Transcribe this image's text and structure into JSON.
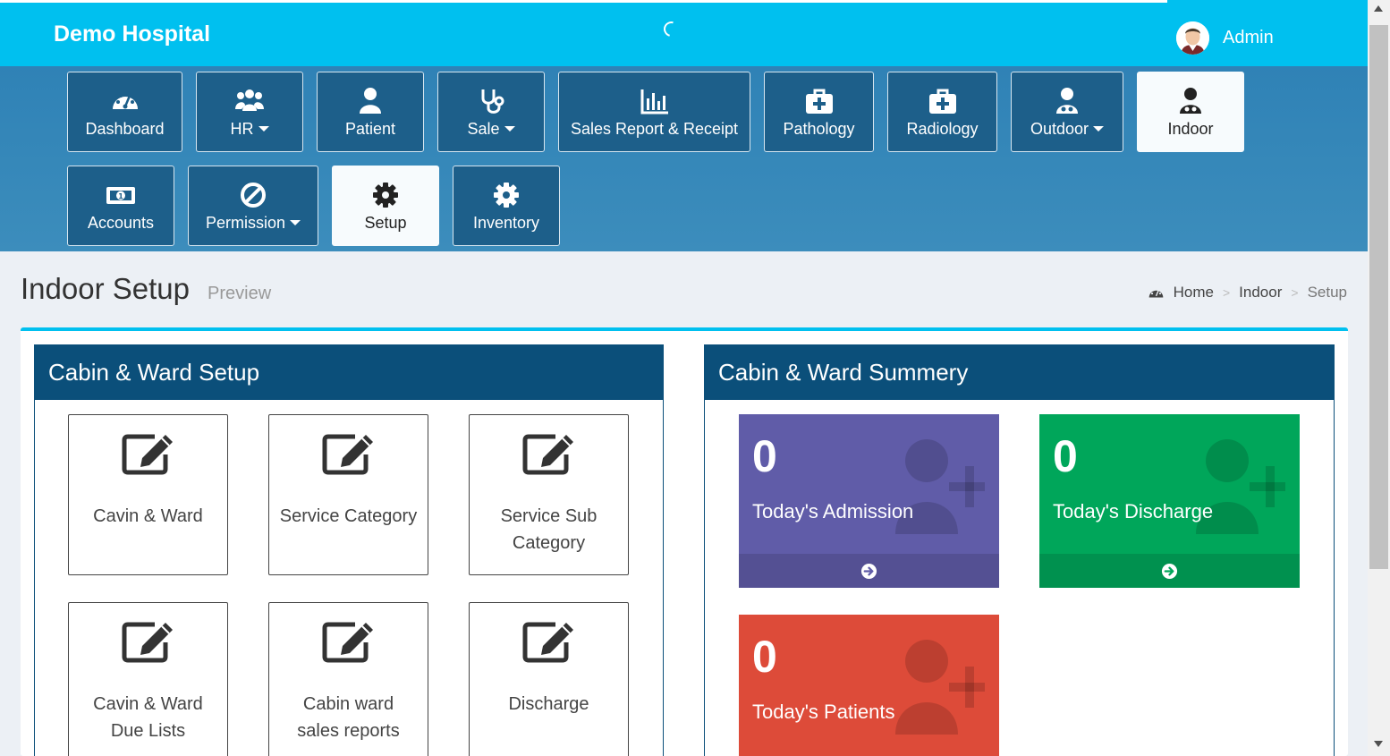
{
  "header": {
    "brand": "Demo Hospital",
    "user_name": "Admin"
  },
  "nav": {
    "items": [
      {
        "label": "Dashboard"
      },
      {
        "label": "HR"
      },
      {
        "label": "Patient"
      },
      {
        "label": "Sale"
      },
      {
        "label": "Sales Report & Receipt"
      },
      {
        "label": "Pathology"
      },
      {
        "label": "Radiology"
      },
      {
        "label": "Outdoor"
      },
      {
        "label": "Indoor"
      },
      {
        "label": "Accounts"
      },
      {
        "label": "Permission"
      },
      {
        "label": "Setup"
      },
      {
        "label": "Inventory"
      }
    ]
  },
  "page": {
    "title": "Indoor Setup",
    "subtitle": "Preview"
  },
  "breadcrumb": {
    "home": "Home",
    "section": "Indoor",
    "current": "Setup"
  },
  "setup_panel": {
    "title": "Cabin & Ward Setup",
    "tiles": [
      {
        "line1": "Cavin & Ward",
        "line2": ""
      },
      {
        "line1": "Service Category",
        "line2": ""
      },
      {
        "line1": "Service Sub",
        "line2": "Category"
      },
      {
        "line1": "Cavin & Ward",
        "line2": "Due Lists"
      },
      {
        "line1": "Cabin ward",
        "line2": "sales reports"
      },
      {
        "line1": "Discharge",
        "line2": ""
      }
    ]
  },
  "summary_panel": {
    "title": "Cabin & Ward Summery",
    "stats": [
      {
        "value": "0",
        "label": "Today's Admission",
        "color": "#605ca8"
      },
      {
        "value": "0",
        "label": "Today's Discharge",
        "color": "#00a65a"
      },
      {
        "value": "0",
        "label": "Today's Patients",
        "color": "#dd4b39"
      }
    ]
  },
  "colors": {
    "topbar": "#00c0ef",
    "nav_bg": "#3c8dbc",
    "nav_button": "#1d5f8a",
    "panel_head": "#0b4f7a"
  }
}
